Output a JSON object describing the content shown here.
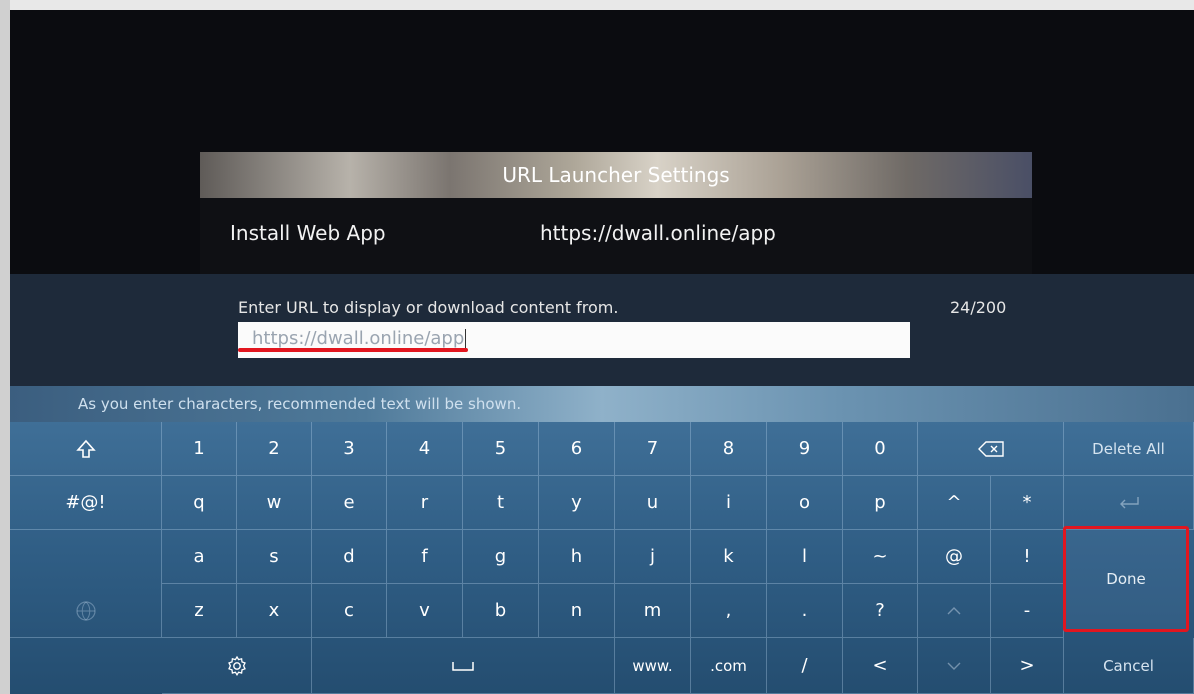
{
  "settings": {
    "title": "URL Launcher Settings",
    "row_label": "Install Web App",
    "row_value": "https://dwall.online/app"
  },
  "entry": {
    "prompt": "Enter URL to display or download content from.",
    "count": "24/200",
    "value": "https://dwall.online/app"
  },
  "hint": "As you enter characters, recommended text will be shown.",
  "keyboard": {
    "row1": [
      "1",
      "2",
      "3",
      "4",
      "5",
      "6",
      "7",
      "8",
      "9",
      "0"
    ],
    "row2": [
      "q",
      "w",
      "e",
      "r",
      "t",
      "y",
      "u",
      "i",
      "o",
      "p",
      "^",
      "*"
    ],
    "row3": [
      "a",
      "s",
      "d",
      "f",
      "g",
      "h",
      "j",
      "k",
      "l",
      "~",
      "@",
      "!"
    ],
    "row4": [
      "z",
      "x",
      "c",
      "v",
      "b",
      "n",
      "m",
      ",",
      ".",
      "?",
      "-"
    ],
    "symbols": "#@!",
    "delete_all": "Delete All",
    "done": "Done",
    "cancel": "Cancel",
    "www": "www.",
    "com": ".com",
    "slash": "/",
    "left_arrow": "<",
    "right_arrow": ">"
  },
  "icons": {
    "shift": "shift-icon",
    "backspace": "backspace-icon",
    "enter": "enter-icon",
    "settings": "gear-icon",
    "space": "space-icon",
    "globe": "globe-icon",
    "up": "chevron-up-icon",
    "down": "chevron-down-icon"
  },
  "colors": {
    "highlight": "#e2161f",
    "keyboard": "#2f5d84"
  }
}
